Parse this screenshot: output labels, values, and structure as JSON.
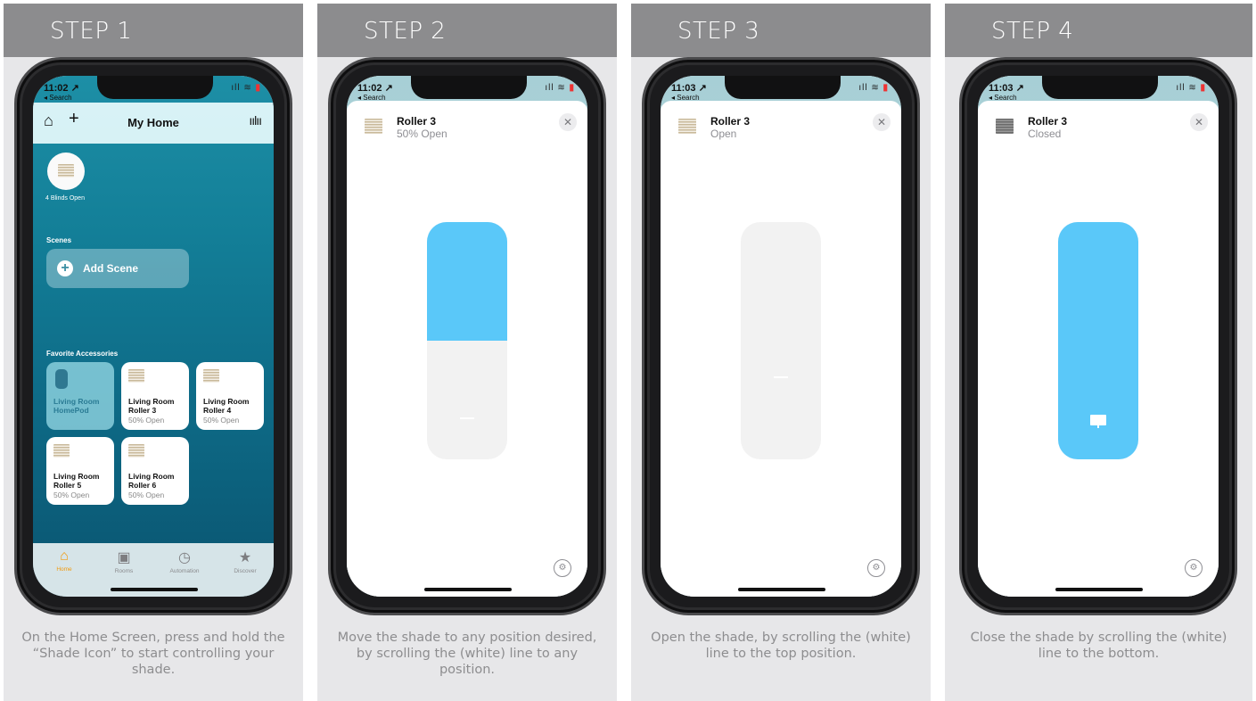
{
  "steps": [
    {
      "header": "STEP 1",
      "caption": "On the Home Screen, press and hold the “Shade Icon” to start controlling your shade.",
      "phone": {
        "time": "11:02 ↗",
        "back": "◂ Search",
        "title": "My Home",
        "blinds_summary": "4 Blinds Open",
        "scenes_label": "Scenes",
        "add_scene": "Add Scene",
        "favorites_label": "Favorite Accessories",
        "tiles": [
          {
            "name1": "Living Room",
            "name2": "HomePod",
            "status": ""
          },
          {
            "name1": "Living Room",
            "name2": "Roller 3",
            "status": "50% Open"
          },
          {
            "name1": "Living Room",
            "name2": "Roller 4",
            "status": "50% Open"
          },
          {
            "name1": "Living Room",
            "name2": "Roller 5",
            "status": "50% Open"
          },
          {
            "name1": "Living Room",
            "name2": "Roller 6",
            "status": "50% Open"
          }
        ],
        "tabs": [
          "Home",
          "Rooms",
          "Automation",
          "Discover"
        ]
      }
    },
    {
      "header": "STEP 2",
      "caption": "Move the shade to any position desired, by scrolling the (white) line to any position.",
      "phone": {
        "time": "11:02 ↗",
        "back": "◂ Search",
        "accessory": "Roller 3",
        "status": "50% Open",
        "closed_fraction": 0.5
      }
    },
    {
      "header": "STEP 3",
      "caption": "Open the shade, by scrolling the (white) line to the top position.",
      "phone": {
        "time": "11:03 ↗",
        "back": "◂ Search",
        "accessory": "Roller 3",
        "status": "Open",
        "closed_fraction": 0
      }
    },
    {
      "header": "STEP 4",
      "caption": "Close the shade by scrolling the (white) line to the bottom.",
      "phone": {
        "time": "11:03 ↗",
        "back": "◂ Search",
        "accessory": "Roller 3",
        "status": "Closed",
        "closed_fraction": 1
      }
    }
  ],
  "colors": {
    "header_bg": "#8c8c8e",
    "panel_bg": "#e7e7e9",
    "slider_blue": "#5ac8f9",
    "home_active": "#f29a0c"
  },
  "icons": {
    "home": "house-icon",
    "add": "plus-icon",
    "voice": "waveform-icon",
    "close": "close-icon",
    "settings": "gear-icon"
  }
}
